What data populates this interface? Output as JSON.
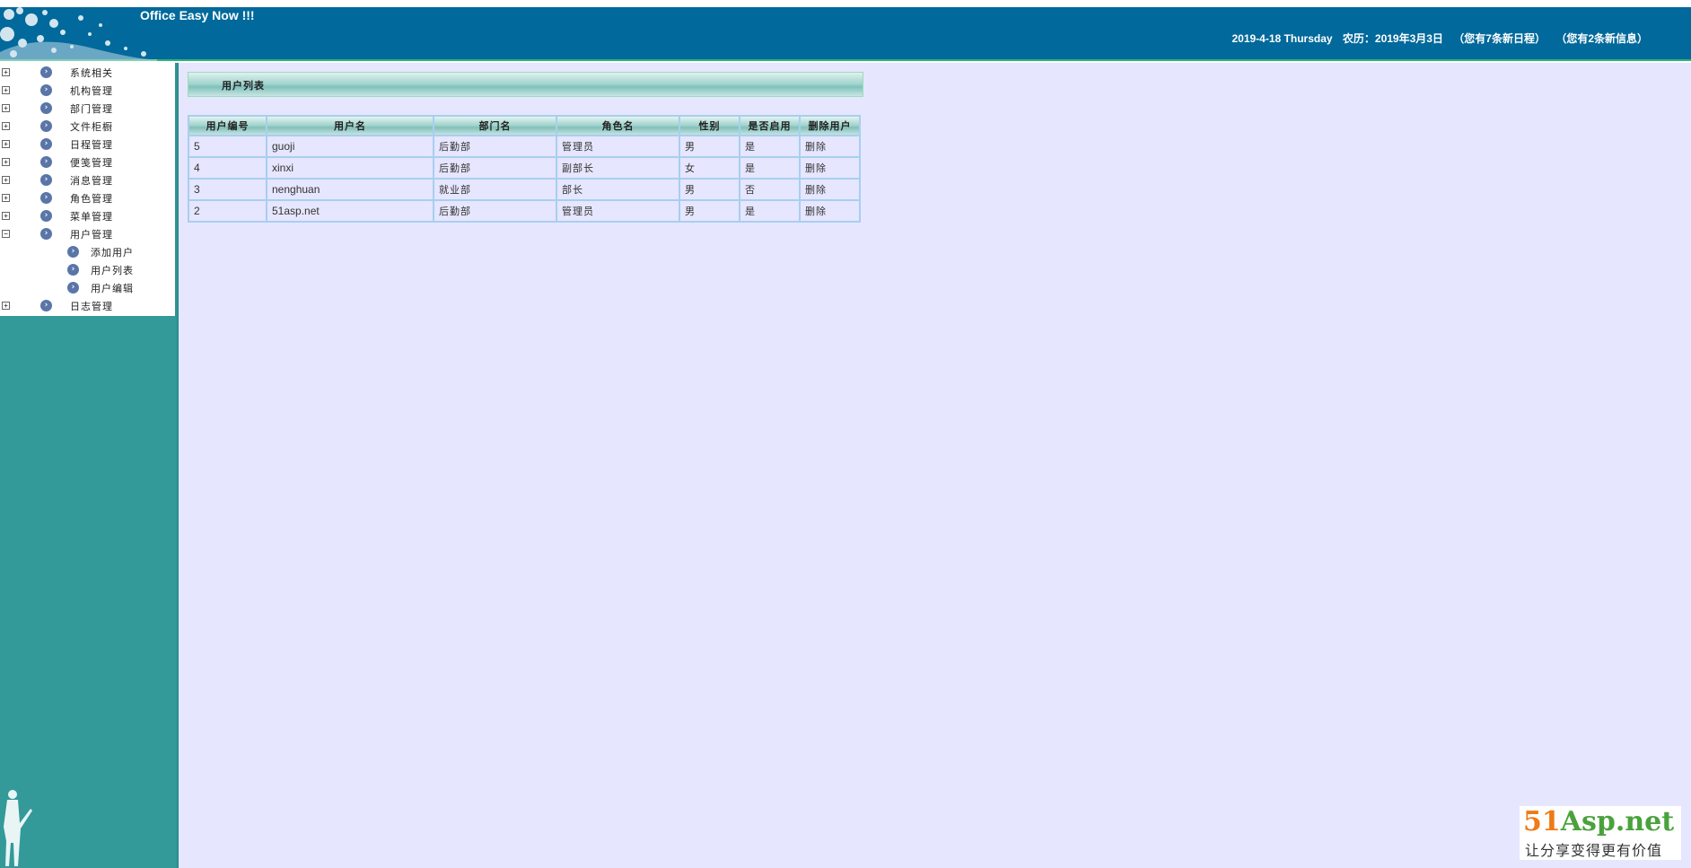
{
  "header": {
    "title": "Office Easy Now !!!",
    "date": "2019-4-18 Thursday",
    "lunar": "农历：2019年3月3日",
    "schedule_note": "（您有7条新日程）",
    "message_note": "（您有2条新信息）"
  },
  "sidebar": {
    "items": [
      {
        "label": "系统相关",
        "toggle": "+"
      },
      {
        "label": "机构管理",
        "toggle": "+"
      },
      {
        "label": "部门管理",
        "toggle": "+"
      },
      {
        "label": "文件柜橱",
        "toggle": "+"
      },
      {
        "label": "日程管理",
        "toggle": "+"
      },
      {
        "label": "便笺管理",
        "toggle": "+"
      },
      {
        "label": "消息管理",
        "toggle": "+"
      },
      {
        "label": "角色管理",
        "toggle": "+"
      },
      {
        "label": "菜单管理",
        "toggle": "+"
      },
      {
        "label": "用户管理",
        "toggle": "−"
      }
    ],
    "subitems": [
      {
        "label": "添加用户"
      },
      {
        "label": "用户列表"
      },
      {
        "label": "用户编辑"
      }
    ],
    "last_item": {
      "label": "日志管理",
      "toggle": "+"
    }
  },
  "main": {
    "panel_title": "用户列表",
    "columns": [
      "用户编号",
      "用户名",
      "部门名",
      "角色名",
      "性别",
      "是否启用",
      "删除用户"
    ],
    "rows": [
      [
        "5",
        "guoji",
        "后勤部",
        "管理员",
        "男",
        "是",
        "删除"
      ],
      [
        "4",
        "xinxi",
        "后勤部",
        "副部长",
        "女",
        "是",
        "删除"
      ],
      [
        "3",
        "nenghuan",
        "就业部",
        "部长",
        "男",
        "否",
        "删除"
      ],
      [
        "2",
        "51asp.net",
        "后勤部",
        "管理员",
        "男",
        "是",
        "删除"
      ]
    ]
  },
  "watermark": {
    "brand_num": "51",
    "brand_rest": "Asp.net",
    "slogan": "让分享变得更有价值"
  },
  "colors": {
    "header_bg": "#01699b",
    "sidebar_bg": "#339999",
    "main_bg": "#e6e6fe",
    "grid_border": "#a7cff0"
  }
}
